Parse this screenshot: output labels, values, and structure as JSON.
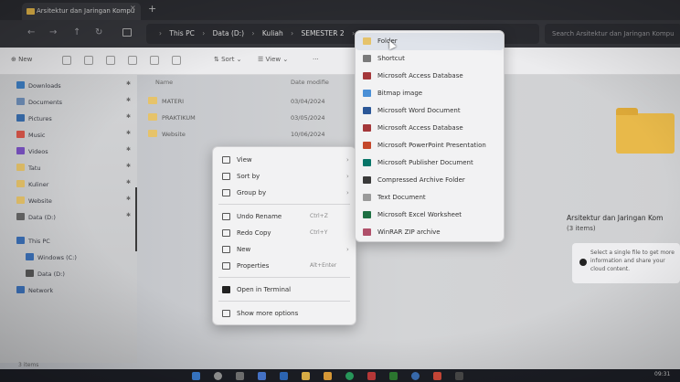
{
  "window": {
    "tab_title": "Arsitektur dan Jaringan Kompu",
    "tab_close": "×",
    "tab_add": "+"
  },
  "nav": {
    "back": "←",
    "forward": "→",
    "up": "↑",
    "refresh": "↻"
  },
  "address": {
    "crumbs": [
      "This PC",
      "Data (D:)",
      "Kuliah",
      "SEMESTER 2",
      "Arsitektur dan Jaringan Komputer"
    ],
    "separator": "›"
  },
  "search": {
    "placeholder": "Search Arsitektur dan Jaringan Kompu"
  },
  "toolbar": {
    "new_label": "New",
    "sort_label": "Sort",
    "view_label": "View",
    "more_label": "···"
  },
  "sidebar": {
    "items": [
      {
        "label": "Downloads",
        "icon": "download-icon",
        "color": "#3e7fc4"
      },
      {
        "label": "Documents",
        "icon": "documents-icon",
        "color": "#6f8fb9"
      },
      {
        "label": "Pictures",
        "icon": "pictures-icon",
        "color": "#3a6fb0"
      },
      {
        "label": "Music",
        "icon": "music-icon",
        "color": "#d9564a"
      },
      {
        "label": "Videos",
        "icon": "videos-icon",
        "color": "#7a52c2"
      },
      {
        "label": "Tatu",
        "icon": "folder-icon",
        "color": "#e6c36a"
      },
      {
        "label": "Kuliner",
        "icon": "folder-icon",
        "color": "#e6c36a"
      },
      {
        "label": "Website",
        "icon": "folder-icon",
        "color": "#e6c36a"
      },
      {
        "label": "Data (D:)",
        "icon": "drive-icon",
        "color": "#666"
      },
      {
        "label": "This PC",
        "icon": "pc-icon",
        "color": "#3b6fb5"
      },
      {
        "label": "Windows (C:)",
        "icon": "drive-icon",
        "color": "#3b6fb5"
      },
      {
        "label": "Data (D:)",
        "icon": "drive-icon",
        "color": "#555"
      },
      {
        "label": "Network",
        "icon": "network-icon",
        "color": "#3b6fb5"
      }
    ]
  },
  "list": {
    "header_name": "Name",
    "header_date": "Date modifie",
    "rows": [
      {
        "name": "MATERI",
        "date": "03/04/2024"
      },
      {
        "name": "PRAKTIKUM",
        "date": "03/05/2024"
      },
      {
        "name": "Website",
        "date": "10/06/2024"
      }
    ]
  },
  "context_menu": {
    "items": [
      {
        "label": "View",
        "icon": "view-icon",
        "shortcut": "",
        "arrow": "›"
      },
      {
        "label": "Sort by",
        "icon": "sort-icon",
        "shortcut": "",
        "arrow": "›"
      },
      {
        "label": "Group by",
        "icon": "group-icon",
        "shortcut": "",
        "arrow": "›"
      },
      {
        "label": "Undo Rename",
        "icon": "undo-icon",
        "shortcut": "Ctrl+Z",
        "arrow": ""
      },
      {
        "label": "Redo Copy",
        "icon": "redo-icon",
        "shortcut": "Ctrl+Y",
        "arrow": ""
      },
      {
        "label": "New",
        "icon": "new-icon",
        "shortcut": "",
        "arrow": "›"
      },
      {
        "label": "Properties",
        "icon": "properties-icon",
        "shortcut": "Alt+Enter",
        "arrow": ""
      },
      {
        "label": "Open in Terminal",
        "icon": "terminal-icon",
        "shortcut": "",
        "arrow": ""
      },
      {
        "label": "Show more options",
        "icon": "more-options-icon",
        "shortcut": "",
        "arrow": ""
      }
    ]
  },
  "new_submenu": {
    "items": [
      {
        "label": "Folder",
        "icon": "folder-icon",
        "color": "#e6c36a",
        "highlight": true
      },
      {
        "label": "Shortcut",
        "icon": "shortcut-icon",
        "color": "#7a7a7a"
      },
      {
        "label": "Microsoft Access Database",
        "icon": "access-icon",
        "color": "#a4373a"
      },
      {
        "label": "Bitmap image",
        "icon": "bitmap-icon",
        "color": "#4a8fd6"
      },
      {
        "label": "Microsoft Word Document",
        "icon": "word-icon",
        "color": "#2b5797"
      },
      {
        "label": "Microsoft Access Database",
        "icon": "access-icon",
        "color": "#a4373a"
      },
      {
        "label": "Microsoft PowerPoint Presentation",
        "icon": "powerpoint-icon",
        "color": "#c4472b"
      },
      {
        "label": "Microsoft Publisher Document",
        "icon": "publisher-icon",
        "color": "#077568"
      },
      {
        "label": "Compressed Archive Folder",
        "icon": "archive-icon",
        "color": "#3a3a3a"
      },
      {
        "label": "Text Document",
        "icon": "text-icon",
        "color": "#9a9a9a"
      },
      {
        "label": "Microsoft Excel Worksheet",
        "icon": "excel-icon",
        "color": "#1d6f42"
      },
      {
        "label": "WinRAR ZIP archive",
        "icon": "winrar-icon",
        "color": "#b0506a"
      }
    ]
  },
  "details": {
    "title": "Arsitektur dan Jaringan Kom",
    "count": "(3 items)",
    "info_text": "Select a single file to get more information and share your cloud content."
  },
  "status": {
    "items": "3 items"
  },
  "taskbar": {
    "clock": "09:31"
  }
}
